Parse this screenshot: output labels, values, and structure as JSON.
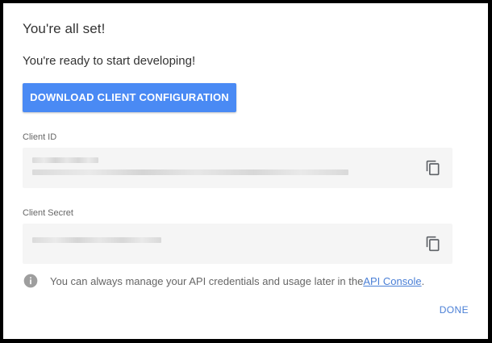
{
  "dialog": {
    "title": "You're all set!",
    "subtitle": "You're ready to start developing!",
    "download_button_label": "DOWNLOAD CLIENT CONFIGURATION",
    "client_id": {
      "label": "Client ID",
      "copy_icon": "copy-icon"
    },
    "client_secret": {
      "label": "Client Secret",
      "copy_icon": "copy-icon"
    },
    "info": {
      "icon": "info-icon",
      "text": "You can always manage your API credentials and usage later in the ",
      "link_text": "API Console",
      "suffix": "."
    },
    "done_button_label": "DONE"
  },
  "colors": {
    "primary_button": "#4a8af4",
    "link": "#4a7fd6",
    "field_background": "#f5f5f5",
    "title_text": "#333333",
    "secondary_text": "#666666"
  }
}
